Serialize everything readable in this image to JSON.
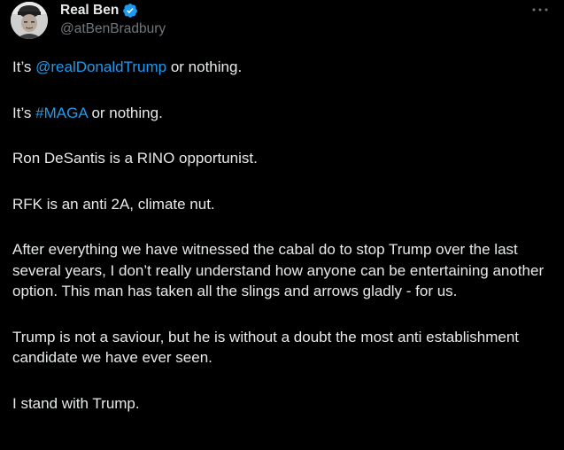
{
  "author": {
    "display_name": "Real Ben",
    "handle": "@atBenBradbury",
    "verified": true,
    "verified_color": "#1d9bf0"
  },
  "icons": {
    "verified": "verified-badge-icon",
    "more": "more-options-icon"
  },
  "tweet": {
    "p1_prefix": "It’s ",
    "p1_mention": "@realDonaldTrump",
    "p1_suffix": " or nothing.",
    "p2_prefix": "It’s ",
    "p2_hashtag": "#MAGA",
    "p2_suffix": " or nothing.",
    "p3": "Ron DeSantis is a RINO opportunist.",
    "p4": "RFK is an anti 2A, climate nut.",
    "p5": "After everything we have witnessed the cabal do to stop Trump over the last several years, I don’t really understand how anyone can be entertaining another option. This man has taken all the slings and arrows gladly - for us.",
    "p6": "Trump is not a saviour, but he is without a doubt the most anti establishment candidate we have ever seen.",
    "p7": "I stand with Trump."
  },
  "colors": {
    "background": "#000000",
    "text": "#e7e9ea",
    "secondary": "#71767b",
    "accent": "#1d9bf0"
  }
}
